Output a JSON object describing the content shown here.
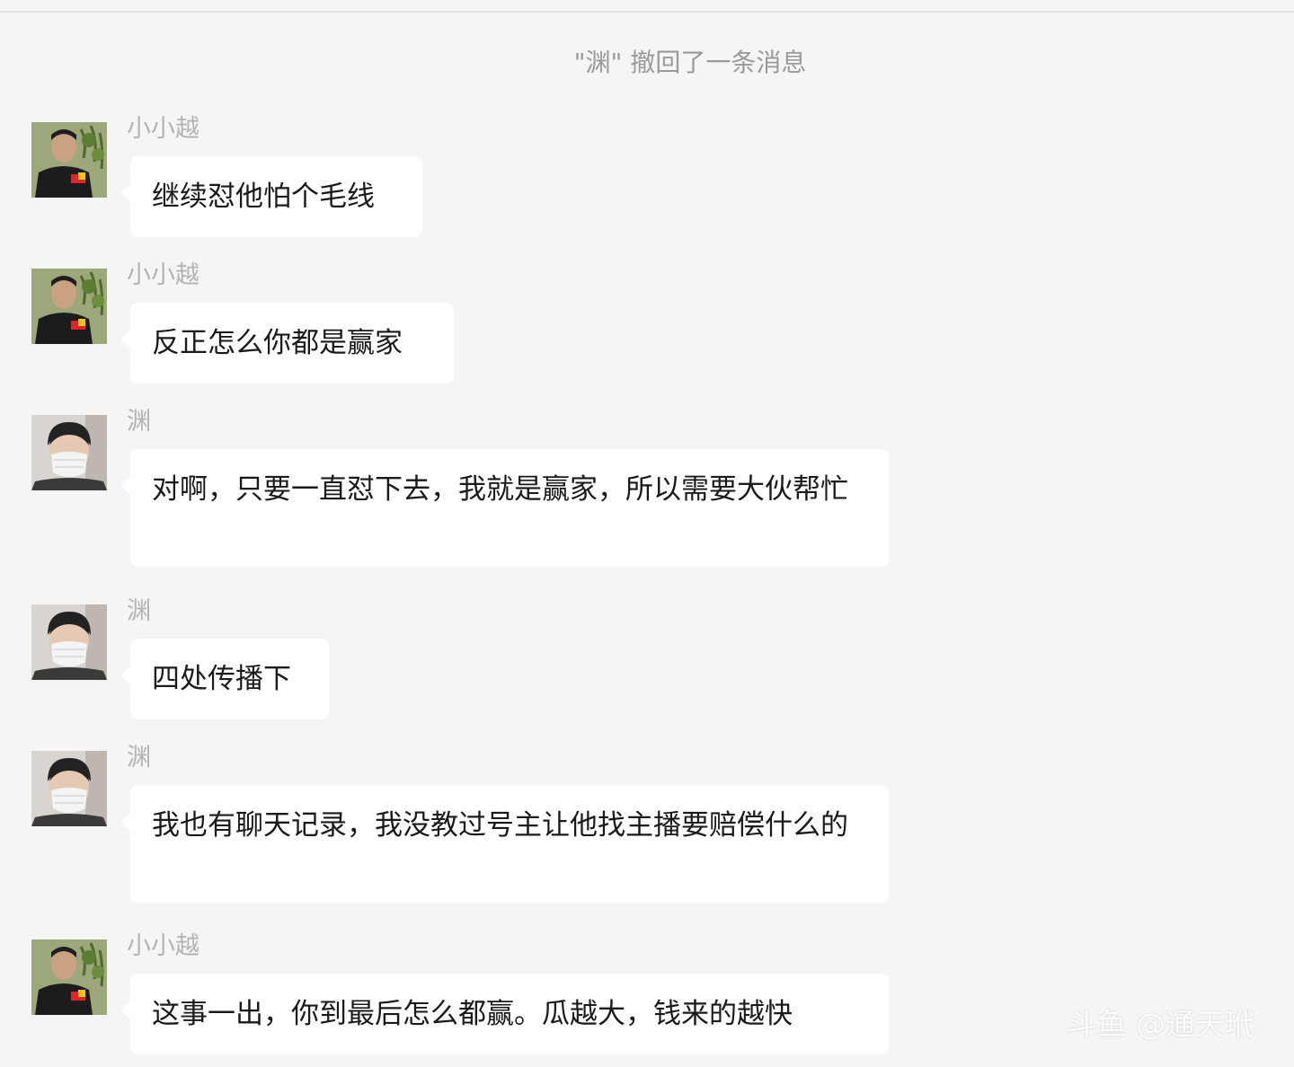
{
  "system_notice": "\"渊\" 撤回了一条消息",
  "messages": [
    {
      "sender": "小小越",
      "avatar": "avatar-xiaoxiaoyue",
      "text": "继续怼他怕个毛线"
    },
    {
      "sender": "小小越",
      "avatar": "avatar-xiaoxiaoyue",
      "text": "反正怎么你都是赢家"
    },
    {
      "sender": "渊",
      "avatar": "avatar-yuan",
      "text": "对啊，只要一直怼下去，我就是赢家，所以需要大伙帮忙"
    },
    {
      "sender": "渊",
      "avatar": "avatar-yuan",
      "text": "四处传播下"
    },
    {
      "sender": "渊",
      "avatar": "avatar-yuan",
      "text": "我也有聊天记录，我没教过号主让他找主播要赔偿什么的"
    },
    {
      "sender": "小小越",
      "avatar": "avatar-xiaoxiaoyue",
      "text": "这事一出，你到最后怎么都赢。瓜越大，钱来的越快"
    }
  ],
  "watermark": "斗鱼 @通天玳"
}
